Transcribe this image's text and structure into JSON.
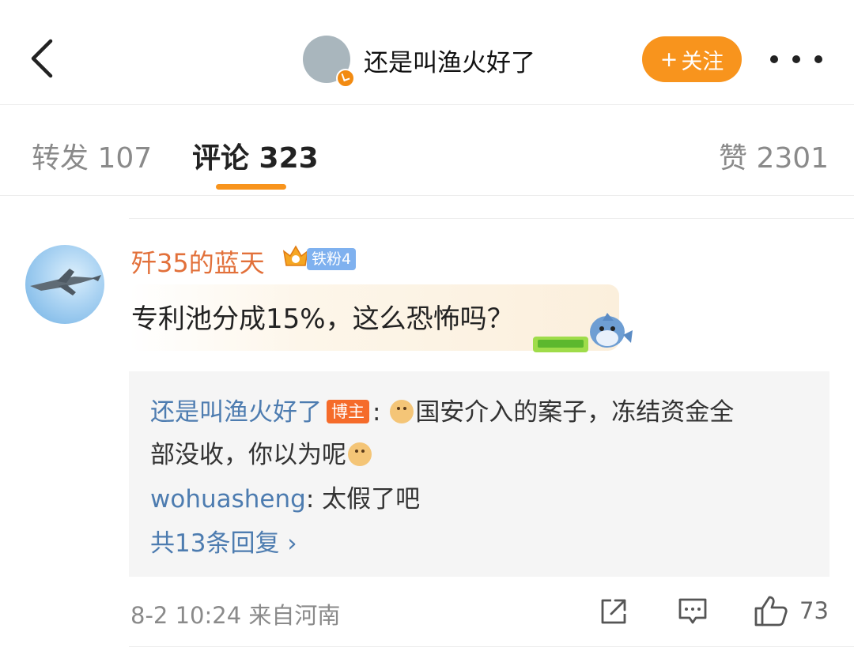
{
  "header": {
    "username": "还是叫渔火好了",
    "follow_label": "关注",
    "follow_plus": "+"
  },
  "tabs": [
    {
      "label": "转发 107"
    },
    {
      "label": "评论 323"
    },
    {
      "label": "赞 2301"
    }
  ],
  "comment": {
    "author": "歼35的蓝天",
    "fan_badge": "铁粉4",
    "text": "专利池分成15%，这么恐怖吗？",
    "replies": {
      "first_author": "还是叫渔火好了",
      "owner_badge": "博主",
      "first_text_a": "国安介入的案子，冻结资金全",
      "first_text_b": "部没收，你以为呢",
      "second_author": "wohuasheng",
      "second_text": ": 太假了吧",
      "more_label": "共13条回复 ›"
    },
    "meta": "8-2 10:24  来自河南",
    "likes": "73"
  },
  "colors": {
    "accent": "#f8941d",
    "link": "#4d7cb0",
    "author": "#e2703a"
  }
}
